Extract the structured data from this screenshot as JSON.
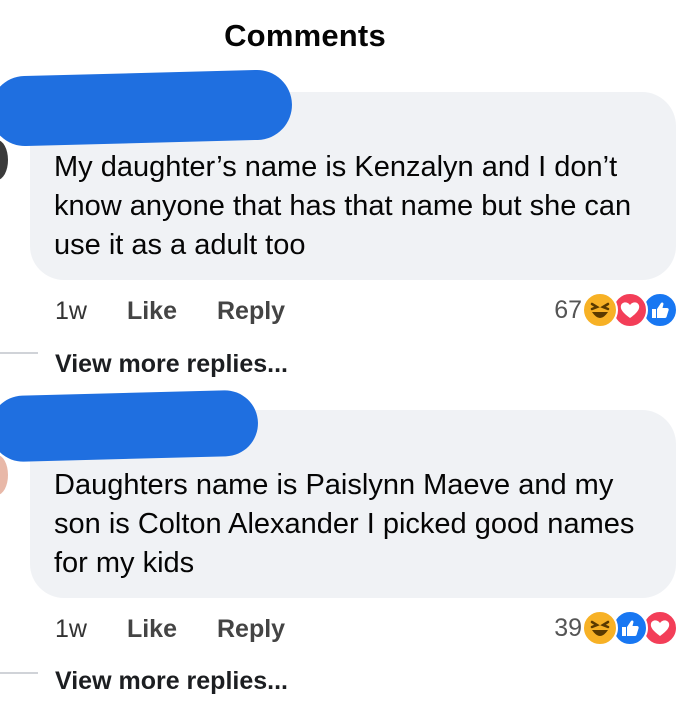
{
  "header": {
    "title": "Comments"
  },
  "comments": [
    {
      "text": "My daughter’s name is Kenzalyn and I don’t know anyone that has that name but she can use it as a adult too",
      "time": "1w",
      "like_label": "Like",
      "reply_label": "Reply",
      "reaction_count": "67",
      "reactions": [
        "haha-icon",
        "love-icon",
        "like-icon"
      ],
      "view_more": "View more replies..."
    },
    {
      "text": "Daughters name is Paislynn Maeve and my son is Colton Alexander I picked good names for my kids",
      "time": "1w",
      "like_label": "Like",
      "reply_label": "Reply",
      "reaction_count": "39",
      "reactions": [
        "haha-icon",
        "like-icon",
        "love-icon"
      ],
      "view_more": "View more replies..."
    }
  ],
  "colors": {
    "bubble": "#f0f2f5",
    "redaction": "#1f6fe0",
    "like": "#1877f2",
    "love": "#f33e58",
    "haha": "#f7b125"
  }
}
